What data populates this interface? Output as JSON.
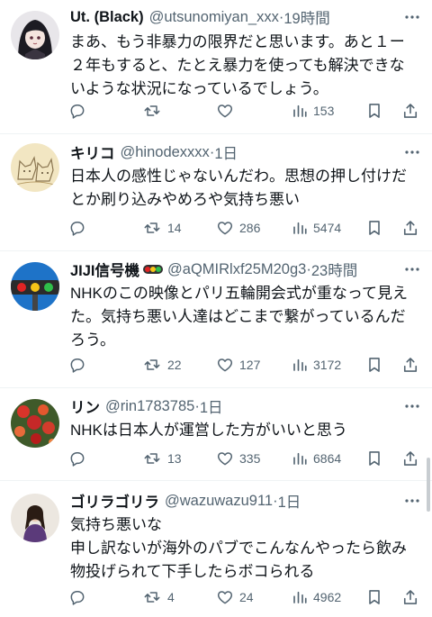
{
  "tweets": [
    {
      "name": "Ut. (Black)",
      "handle": "@utsunomiyan_xxx",
      "separator": "·",
      "time": "19時間",
      "text": "まあ、もう非暴力の限界だと思います。あと１ー２年もすると、たとえ暴力を使っても解決できないような状況になっているでしょう。",
      "reply_count": "",
      "retweet_count": "",
      "like_count": "",
      "view_count": "153",
      "avatar_icon": "anime-avatar"
    },
    {
      "name": "キリコ",
      "handle": "@hinodexxxx",
      "separator": "·",
      "time": "1日",
      "text": "日本人の感性じゃないんだわ。思想の押し付けだとか刷り込みやめろや気持ち悪い",
      "reply_count": "",
      "retweet_count": "14",
      "like_count": "286",
      "view_count": "5474",
      "avatar_icon": "cat-sketch-avatar"
    },
    {
      "name": "JIJI信号機",
      "handle": "@aQMIRlxf25M20g3",
      "separator": "·",
      "time": "23時間",
      "text": "NHKのこの映像とパリ五輪開会式が重なって見えた。気持ち悪い人達はどこまで繋がっているんだろう。",
      "reply_count": "",
      "retweet_count": "22",
      "like_count": "127",
      "view_count": "3172",
      "avatar_icon": "traffic-light-avatar",
      "name_emoji": "traffic-light-icon"
    },
    {
      "name": "リン",
      "handle": "@rin1783785",
      "separator": "·",
      "time": "1日",
      "text": "NHKは日本人が運営した方がいいと思う",
      "reply_count": "",
      "retweet_count": "13",
      "like_count": "335",
      "view_count": "6864",
      "avatar_icon": "flowers-avatar"
    },
    {
      "name": "ゴリラゴリラ",
      "handle": "@wazuwazu911",
      "separator": "·",
      "time": "1日",
      "text": "気持ち悪いな\n申し訳ないが海外のパブでこんなんやったら飲み物投げられて下手したらボコられる",
      "reply_count": "",
      "retweet_count": "4",
      "like_count": "24",
      "view_count": "4962",
      "avatar_icon": "person-avatar"
    }
  ],
  "colors": {
    "text": "#0f1419",
    "secondary": "#536471",
    "divider": "#eff3f4"
  }
}
